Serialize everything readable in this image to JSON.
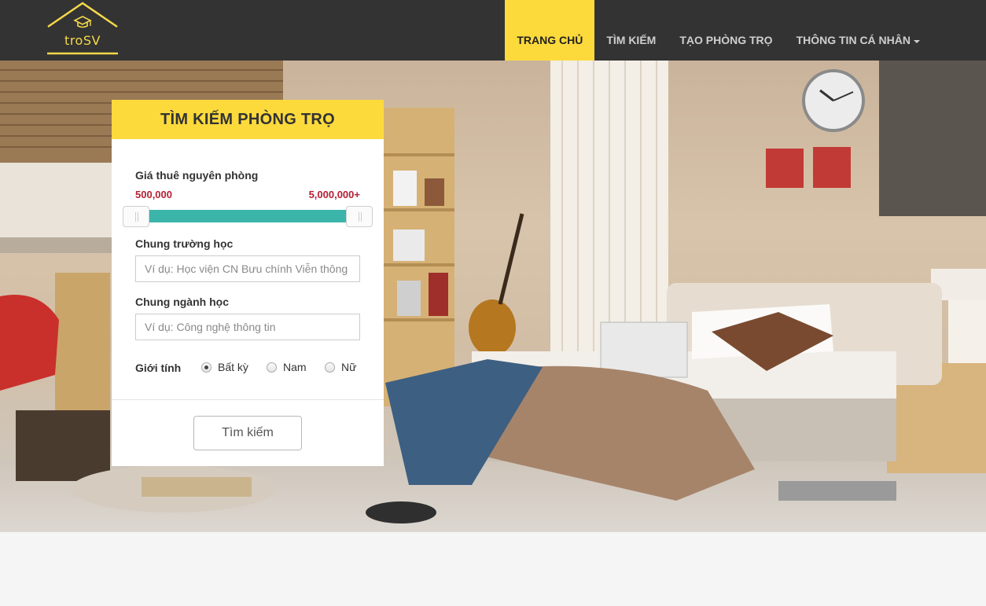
{
  "brand": {
    "name": "troSV",
    "accent": "#fdda3c"
  },
  "nav": {
    "items": [
      {
        "label": "TRANG CHỦ",
        "active": true
      },
      {
        "label": "TÌM KIẾM",
        "active": false
      },
      {
        "label": "TẠO PHÒNG TRỌ",
        "active": false
      },
      {
        "label": "THÔNG TIN CÁ NHÂN",
        "active": false,
        "dropdown": true
      }
    ]
  },
  "search_panel": {
    "title": "TÌM KIẾM PHÒNG TRỌ",
    "price": {
      "label": "Giá thuê nguyên phòng",
      "min_label": "500,000",
      "max_label": "5,000,000+",
      "range_color": "#3bb5a9"
    },
    "school": {
      "label": "Chung trường học",
      "placeholder": "Ví dụ: Học viện CN Bưu chính Viễn thông"
    },
    "major": {
      "label": "Chung ngành học",
      "placeholder": "Ví dụ: Công nghệ thông tin"
    },
    "gender": {
      "label": "Giới tính",
      "options": [
        {
          "label": "Bất kỳ",
          "checked": true
        },
        {
          "label": "Nam",
          "checked": false
        },
        {
          "label": "Nữ",
          "checked": false
        }
      ]
    },
    "submit_label": "Tìm kiếm"
  }
}
